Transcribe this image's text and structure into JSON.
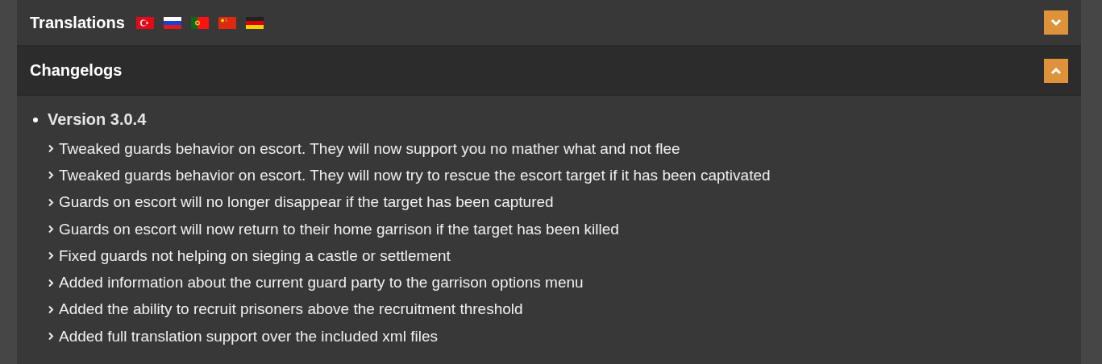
{
  "sections": [
    {
      "title": "Translations",
      "expanded": false,
      "flags": [
        {
          "kind": "tr"
        },
        {
          "kind": "ru"
        },
        {
          "kind": "pt"
        },
        {
          "kind": "cn"
        },
        {
          "kind": "de"
        }
      ]
    },
    {
      "title": "Changelogs",
      "expanded": true,
      "versions": [
        {
          "title": "Version 3.0.4",
          "items": [
            "Tweaked guards behavior on escort. They will now support you no mather what and not flee",
            "Tweaked guards behavior on escort. They will now try to rescue the escort target if it has been captivated",
            "Guards on escort will no longer disappear if the target has been captured",
            "Guards on escort will now return to their home garrison if the target has been killed",
            "Fixed guards not helping on sieging a castle or settlement",
            "Added information about the current guard party to the garrison options menu",
            "Added the ability to recruit prisoners above the recruitment threshold",
            "Added full translation support over the included xml files"
          ]
        }
      ]
    }
  ]
}
